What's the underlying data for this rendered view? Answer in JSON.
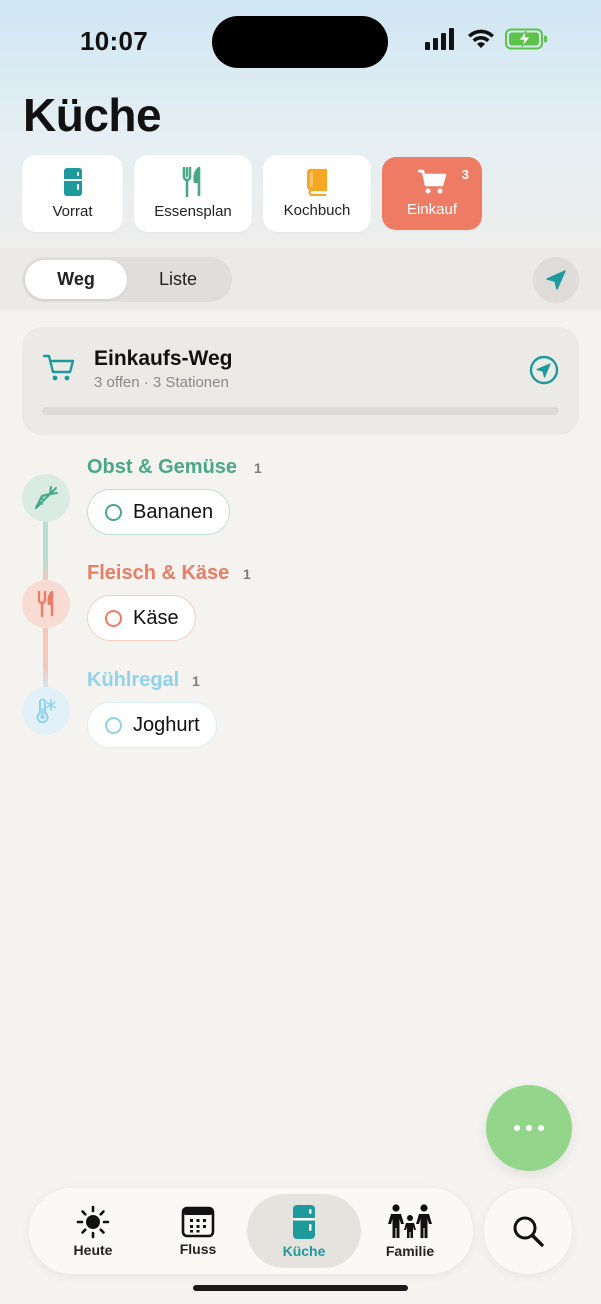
{
  "status_bar": {
    "time": "10:07"
  },
  "page": {
    "title": "Küche"
  },
  "section_tabs": [
    {
      "label": "Vorrat",
      "icon": "fridge-icon"
    },
    {
      "label": "Essensplan",
      "icon": "fork-knife-icon"
    },
    {
      "label": "Kochbuch",
      "icon": "book-icon"
    },
    {
      "label": "Einkauf",
      "icon": "cart-icon",
      "badge": "3",
      "active": true
    }
  ],
  "view_toggle": {
    "options": [
      "Weg",
      "Liste"
    ],
    "selected": "Weg"
  },
  "route_card": {
    "title": "Einkaufs-Weg",
    "subtitle": "3 offen · 3 Stationen",
    "progress": 0
  },
  "stations": [
    {
      "name": "Obst & Gemüse",
      "count": "1",
      "icon": "carrot-icon",
      "color": "#4aa88a",
      "items": [
        {
          "label": "Bananen"
        }
      ]
    },
    {
      "name": "Fleisch & Käse",
      "count": "1",
      "icon": "fork-knife-icon",
      "color": "#e97d66",
      "items": [
        {
          "label": "Käse"
        }
      ]
    },
    {
      "name": "Kühlregal",
      "count": "1",
      "icon": "thermometer-snow-icon",
      "color": "#8fd3ea",
      "items": [
        {
          "label": "Joghurt"
        }
      ]
    }
  ],
  "tabbar": [
    {
      "label": "Heute",
      "icon": "sun-icon"
    },
    {
      "label": "Fluss",
      "icon": "calendar-icon"
    },
    {
      "label": "Küche",
      "icon": "fridge-icon",
      "active": true
    },
    {
      "label": "Familie",
      "icon": "family-icon"
    }
  ],
  "colors": {
    "accent": "#1e9a9c",
    "einkauf": "#ee7b64",
    "fab": "#92d58b"
  }
}
